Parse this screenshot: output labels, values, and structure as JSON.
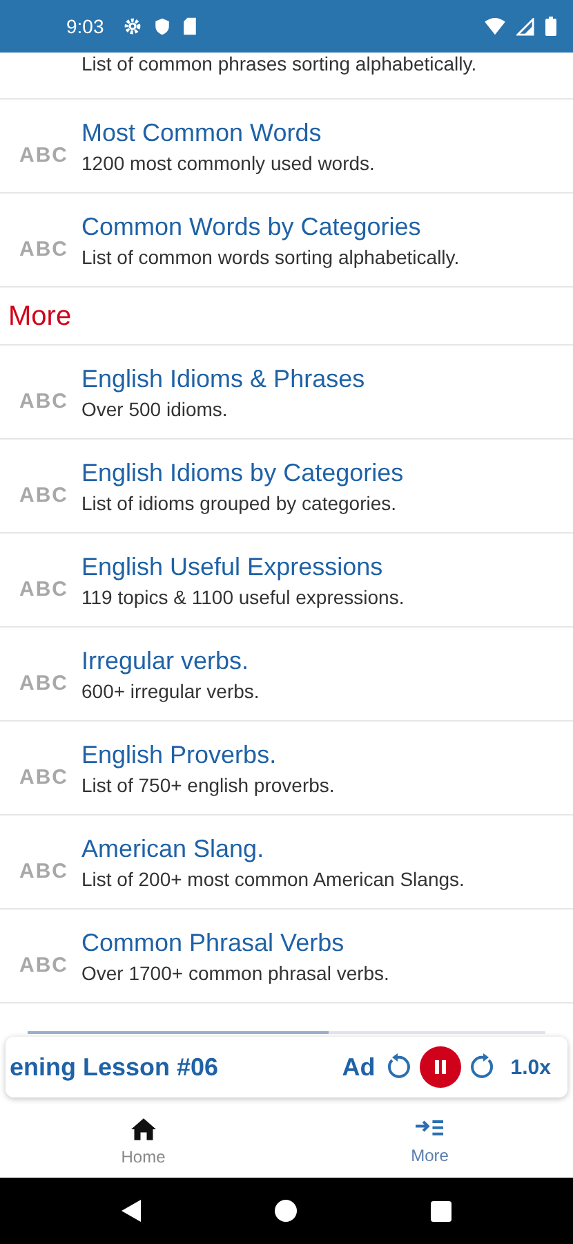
{
  "status_bar": {
    "time": "9:03"
  },
  "top_items": [
    {
      "subtitle": "List of common phrases sorting alphabetically."
    },
    {
      "title": "Most Common Words",
      "subtitle": "1200 most commonly used words.",
      "badge": "ABC"
    },
    {
      "title": "Common Words by Categories",
      "subtitle": "List of common words sorting alphabetically.",
      "badge": "ABC"
    }
  ],
  "section_title": "More",
  "more_items": [
    {
      "title": "English Idioms & Phrases",
      "subtitle": "Over 500 idioms.",
      "badge": "ABC"
    },
    {
      "title": "English Idioms by Categories",
      "subtitle": "List of idioms grouped by categories.",
      "badge": "ABC"
    },
    {
      "title": "English Useful Expressions",
      "subtitle": "119 topics & 1100 useful expressions.",
      "badge": "ABC"
    },
    {
      "title": "Irregular verbs.",
      "subtitle": "600+ irregular verbs.",
      "badge": "ABC"
    },
    {
      "title": "English Proverbs.",
      "subtitle": "List of 750+ english proverbs.",
      "badge": "ABC"
    },
    {
      "title": "American Slang.",
      "subtitle": "List of 200+ most common American Slangs.",
      "badge": "ABC"
    },
    {
      "title": "Common Phrasal Verbs",
      "subtitle": "Over 1700+ common phrasal verbs.",
      "badge": "ABC"
    }
  ],
  "player": {
    "title": "ening Lesson #06",
    "next_title": "Ad",
    "speed": "1.0x",
    "level": 0.58,
    "playing": true
  },
  "tabs": [
    {
      "label": "Home",
      "selected": false
    },
    {
      "label": "More",
      "selected": true
    }
  ]
}
